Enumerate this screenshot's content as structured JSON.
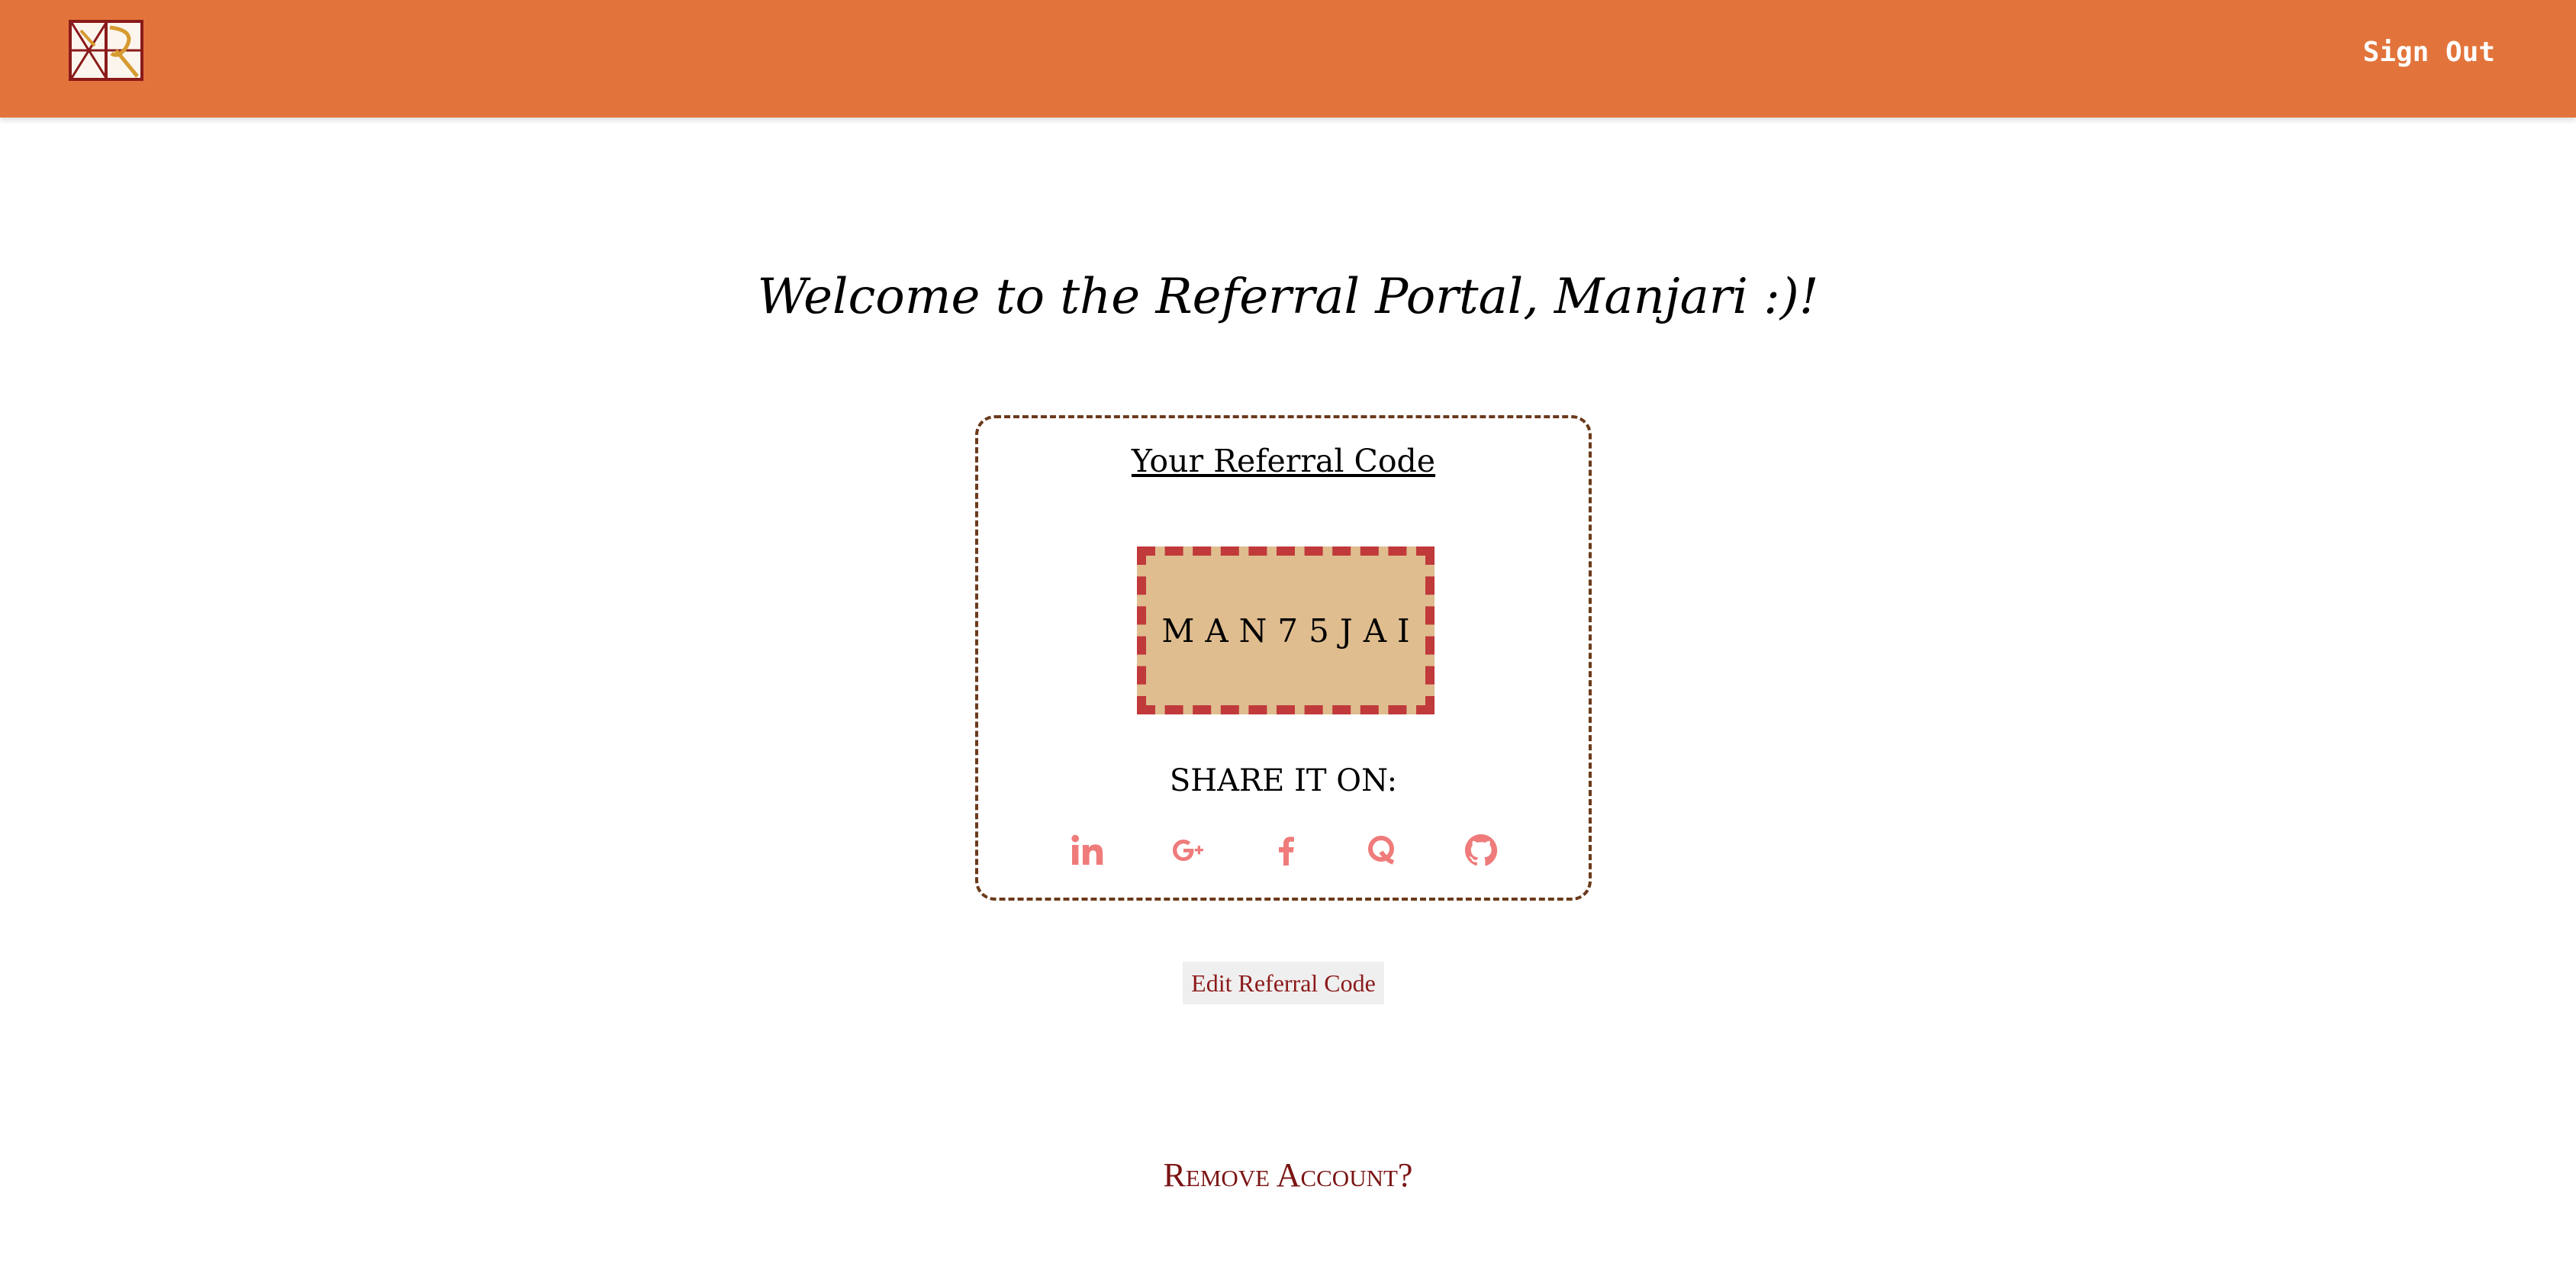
{
  "header": {
    "logo_icon": "monogram-logo-icon",
    "signout_label": "Sign Out",
    "bar_color": "#e2743b"
  },
  "main": {
    "welcome": "Welcome to the Referral Portal, Manjari :)!"
  },
  "card": {
    "title": "Your Referral Code",
    "code": "MAN75JAI",
    "code_bg": "#dfbd8f",
    "code_border": "#c0393b",
    "share_label": "SHARE IT ON:",
    "social": [
      {
        "name": "linkedin-icon"
      },
      {
        "name": "google-plus-icon"
      },
      {
        "name": "facebook-icon"
      },
      {
        "name": "quora-icon"
      },
      {
        "name": "github-icon"
      }
    ],
    "icon_color": "#ef7b7b"
  },
  "actions": {
    "edit_label": "Edit Referral Code",
    "remove_label": "Remove Account?"
  }
}
